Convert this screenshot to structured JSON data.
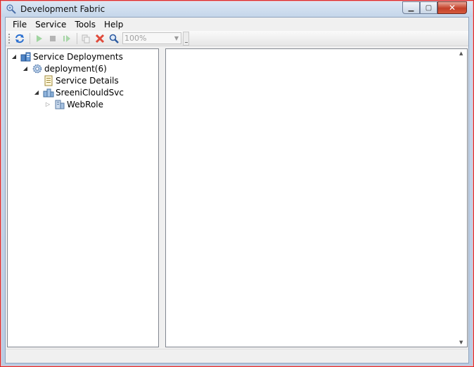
{
  "window": {
    "title": "Development Fabric"
  },
  "caption": {
    "minimize": "▁",
    "maximize": "▢",
    "close": "✕"
  },
  "menu": [
    {
      "label": "File"
    },
    {
      "label": "Service"
    },
    {
      "label": "Tools"
    },
    {
      "label": "Help"
    }
  ],
  "toolbar": {
    "buttons": [
      {
        "icon": "refresh-icon",
        "enabled": true
      },
      {
        "icon": "run-icon",
        "enabled": false
      },
      {
        "icon": "stop-icon",
        "enabled": false
      },
      {
        "icon": "restart-icon",
        "enabled": false
      },
      {
        "icon": "copy-icon",
        "enabled": false
      },
      {
        "icon": "delete-icon",
        "enabled": true
      },
      {
        "icon": "zoom-icon",
        "enabled": true
      }
    ],
    "zoom_value": "100%"
  },
  "tree": {
    "root": {
      "label": "Service Deployments",
      "icon": "service-deployments-icon",
      "expanded": true
    },
    "deployment": {
      "label": "deployment(6)",
      "icon": "deployment-gear-icon",
      "expanded": true
    },
    "service_details": {
      "label": "Service Details",
      "icon": "document-icon"
    },
    "service": {
      "label": "SreeniClouldSvc",
      "icon": "cloud-service-icon",
      "expanded": true
    },
    "role": {
      "label": "WebRole",
      "icon": "web-role-icon",
      "expanded": false
    }
  },
  "colors": {
    "window_border": "#d9262a",
    "close_button": "#c4402a",
    "client_bg": "#f0f0f0"
  }
}
